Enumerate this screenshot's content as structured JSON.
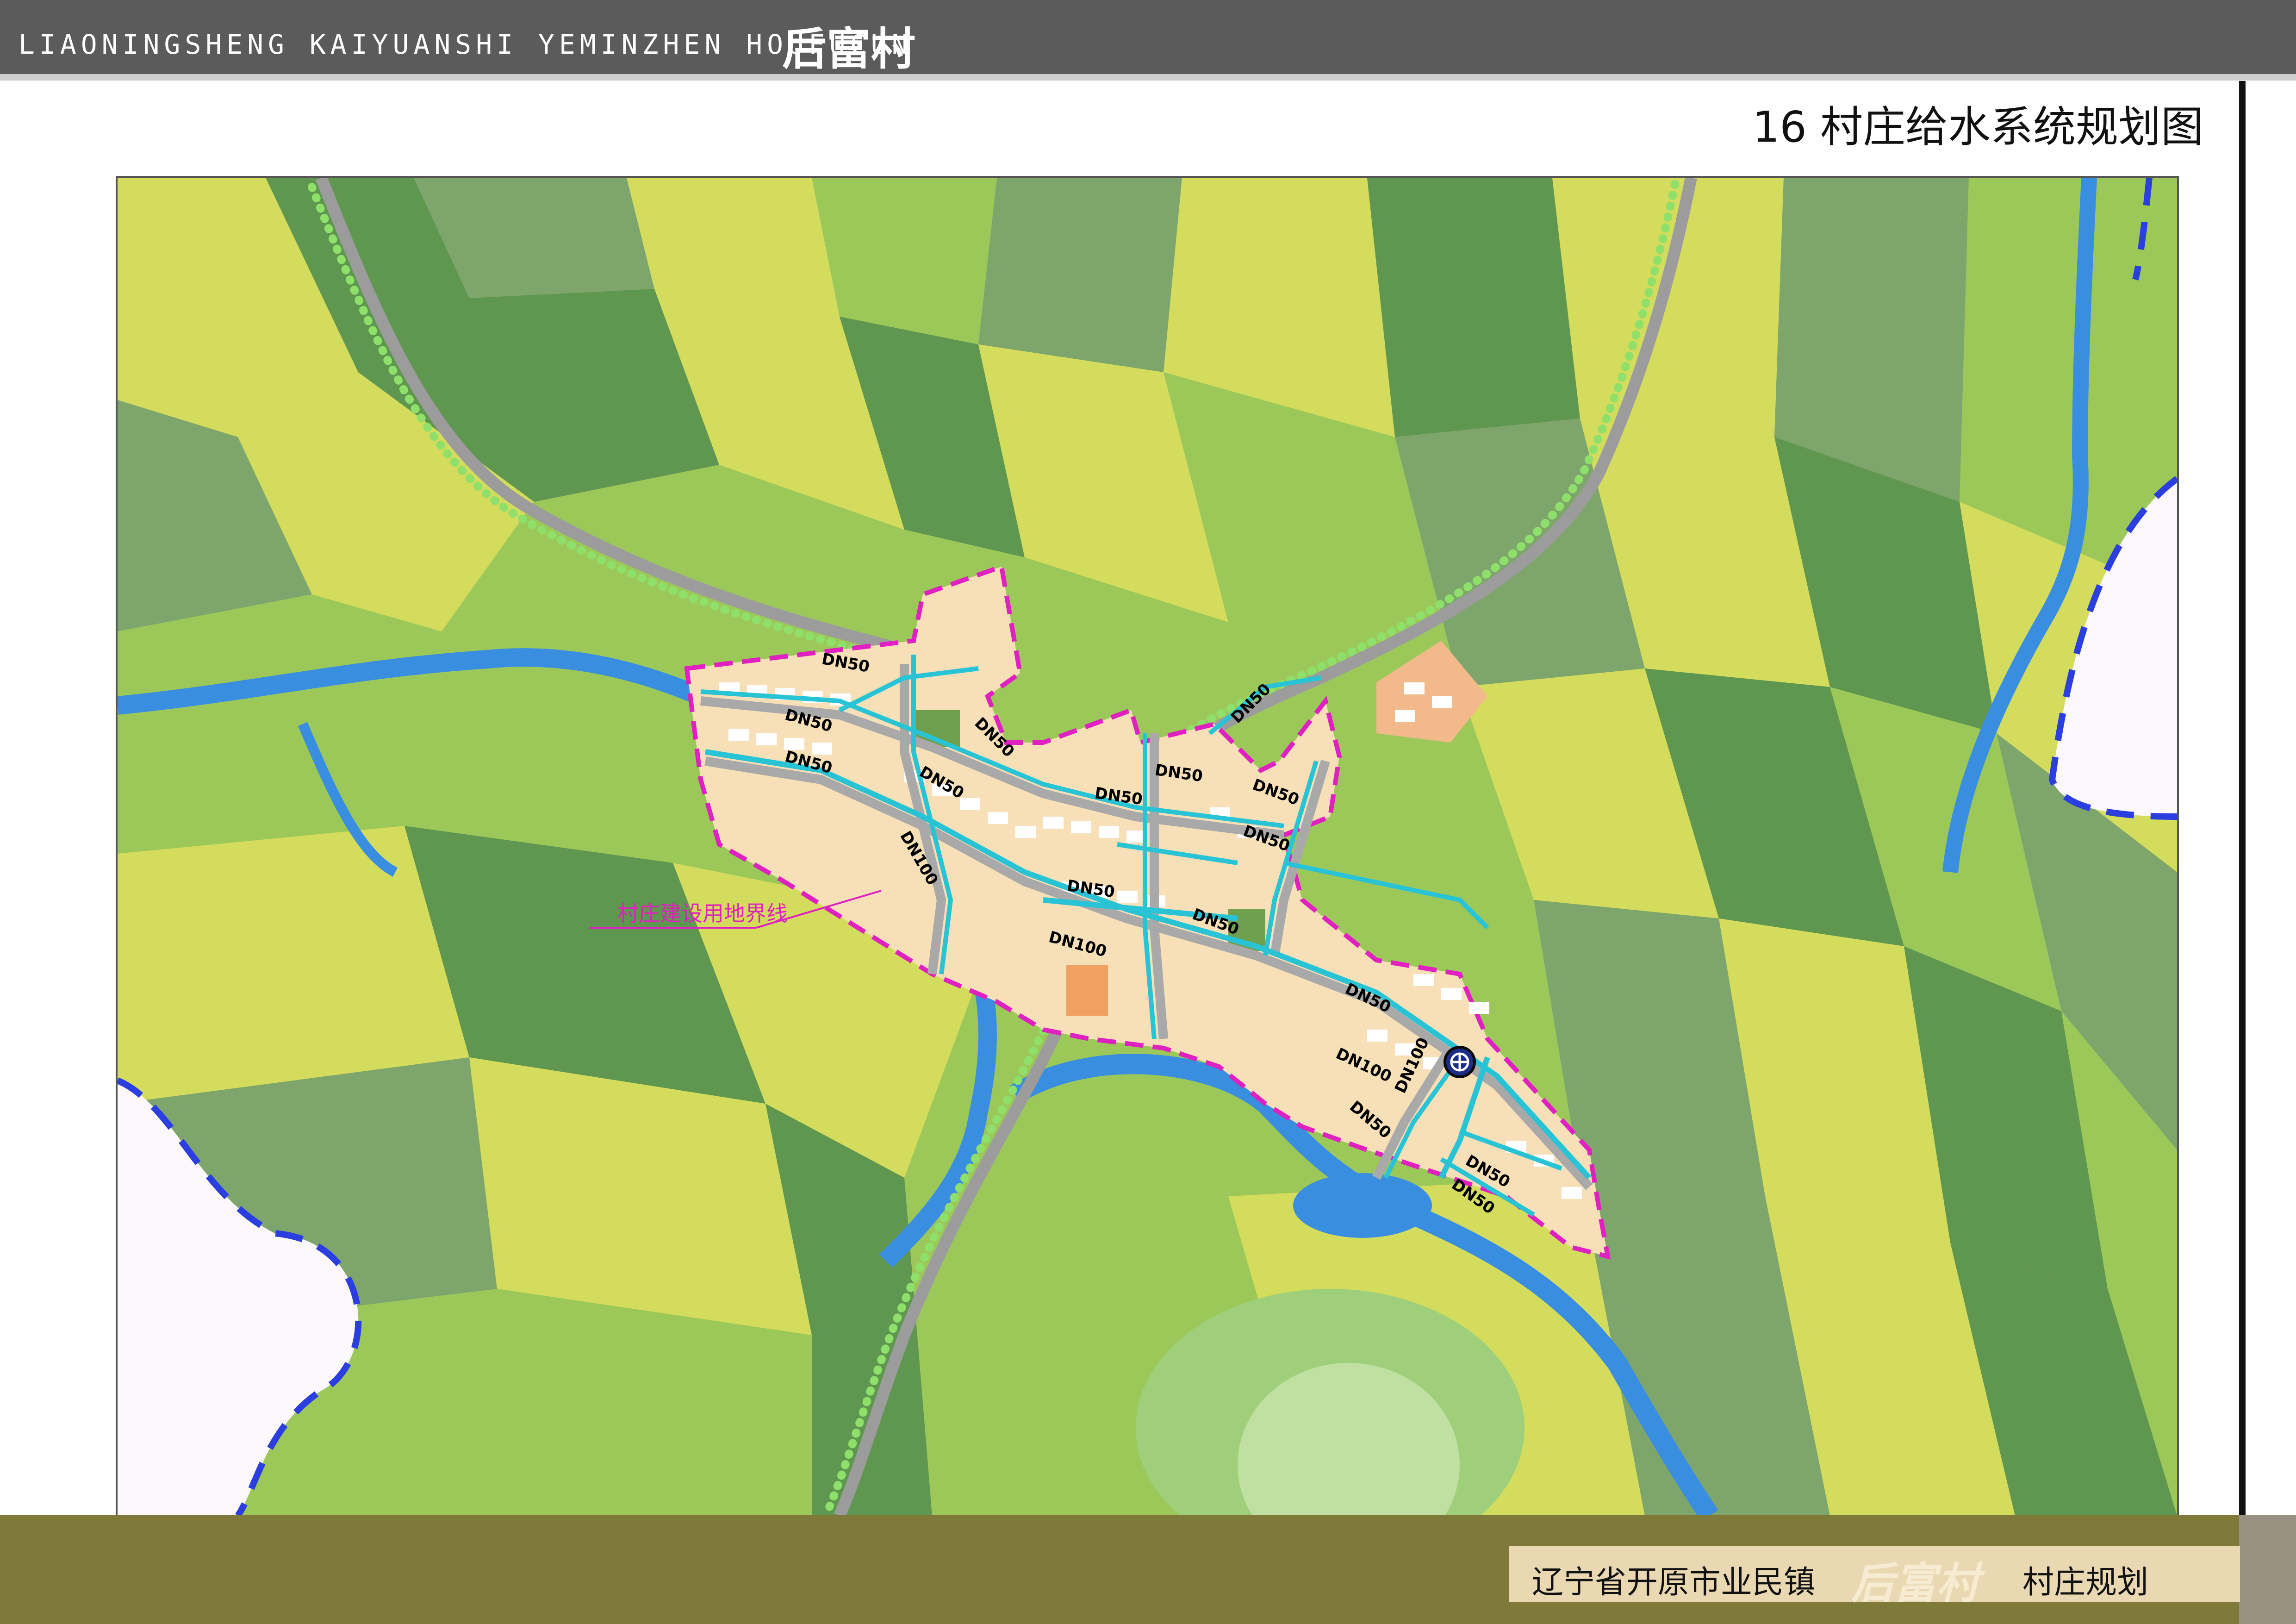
{
  "header": {
    "pinyin_title": "LIAONINGSHENG KAIYUANSHI YEMINZHEN HOUFUCUN",
    "chinese_title": "后富村"
  },
  "sheet_title": "16  村庄给水系统规划图",
  "map": {
    "boundary_label": "村庄建设用地界线",
    "pipe_labels": [
      "DN50",
      "DN50",
      "DN50",
      "DN50",
      "DN50",
      "DN50",
      "DN50",
      "DN50",
      "DN50",
      "DN50",
      "DN50",
      "DN50",
      "DN50",
      "DN50",
      "DN50",
      "DN50",
      "DN100",
      "DN100",
      "DN100",
      "DN100"
    ],
    "colors": {
      "field_light": "#d3dc5c",
      "field_mid": "#9cc85a",
      "field_dark": "#5f9650",
      "field_gray": "#7ea66c",
      "water": "#3a8ee0",
      "village": "#f7dfb8",
      "road": "#9c9c9c",
      "pipe": "#29c3d6",
      "boundary": "#e020c0",
      "outside": "#fdf8fb",
      "admin_boundary": "#2b3fe0"
    },
    "icons": [
      "water-plant-icon"
    ]
  },
  "footer": {
    "location": "辽宁省开原市业民镇",
    "village": "后富村",
    "suffix": "村庄规划"
  }
}
